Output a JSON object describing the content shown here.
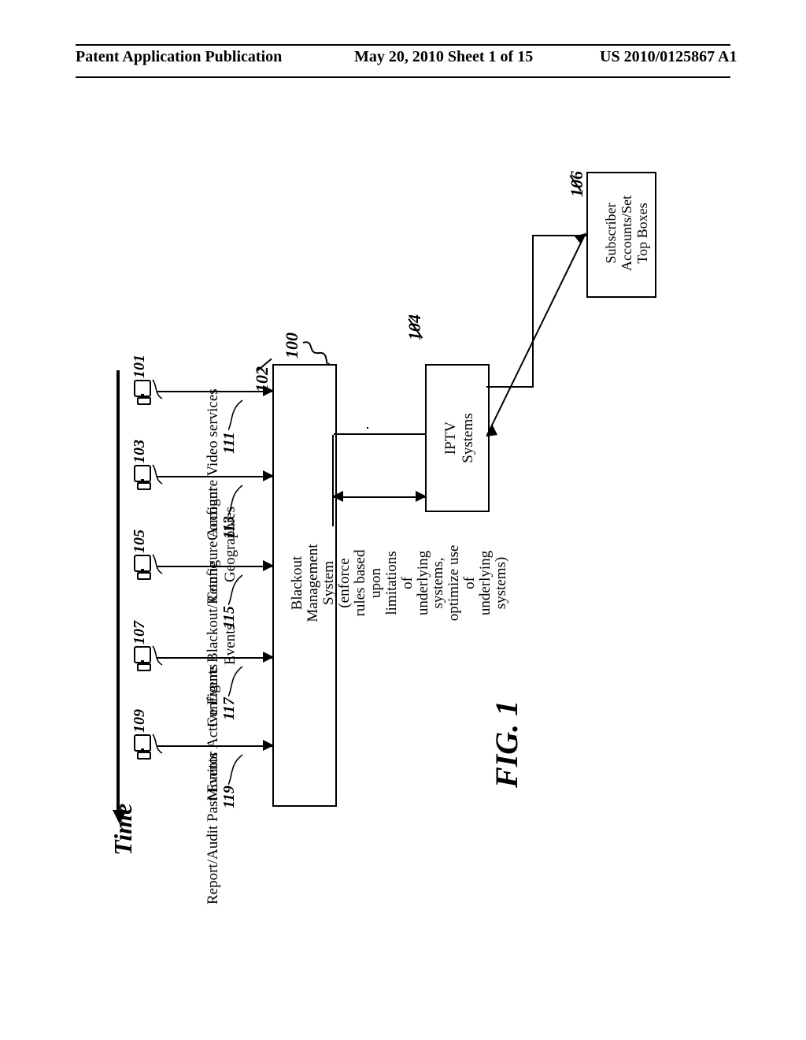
{
  "header": {
    "left": "Patent Application Publication",
    "center": "May 20, 2010  Sheet 1 of 15",
    "right": "US 2010/0125867 A1"
  },
  "refs": {
    "r100": "100",
    "r101": "101",
    "r102": "102",
    "r103": "103",
    "r104": "104",
    "r105": "105",
    "r106": "106",
    "r107": "107",
    "r109": "109",
    "r111": "111",
    "r113": "113",
    "r115": "115",
    "r117": "117",
    "r119": "119"
  },
  "boxes": {
    "bms": "Blackout\nManagement\nSystem\n(enforce\nrules based\nupon\nlimitations\nof\nunderlying\nsystems,\noptimize use\nof\nunderlying\nsystems)",
    "iptv": "IPTV\nSystems",
    "sub": "Subscriber\nAccounts/Set\nTop Boxes"
  },
  "ops": {
    "o1": "Configure Video services",
    "o2": "Configure Account\nGeographies",
    "o3": "Configure Blackout/Retune\nEvents",
    "o4": "Monitor Active Events",
    "o5": "Report/Audit Past Events"
  },
  "labels": {
    "time": "Time",
    "fig": "FIG. 1"
  }
}
